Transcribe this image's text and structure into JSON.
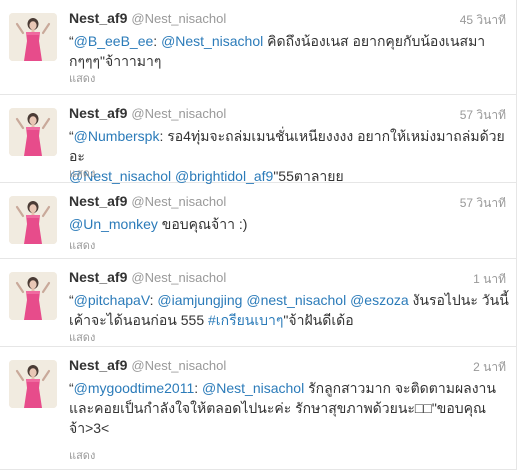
{
  "tweets": [
    {
      "name": "Nest_af9",
      "screen_name": "@Nest_nisachol",
      "time": "45 วินาที",
      "expand": "แสดง",
      "parts": [
        {
          "t": "text",
          "v": "“"
        },
        {
          "t": "mention",
          "v": "@B_eeB_ee"
        },
        {
          "t": "text",
          "v": ": "
        },
        {
          "t": "mention",
          "v": "@Nest_nisachol"
        },
        {
          "t": "text",
          "v": " คิดถึงน้องเนส อยากคุยกับน้องเนสมา\nกๆๆๆ\"จ้าาามาๆ"
        }
      ]
    },
    {
      "name": "Nest_af9",
      "screen_name": "@Nest_nisachol",
      "time": "57 วินาที",
      "expand": "แสดง",
      "parts": [
        {
          "t": "text",
          "v": "“"
        },
        {
          "t": "mention",
          "v": "@Numberspk"
        },
        {
          "t": "text",
          "v": ": รอ4ทุ่มจะถล่มเมนชั่นเหนียงงงง อยากให้เหม่งมาถล่มด้วยอะ\n"
        },
        {
          "t": "mention",
          "v": "@Nest_nisachol"
        },
        {
          "t": "text",
          "v": " "
        },
        {
          "t": "mention",
          "v": "@brightidol_af9"
        },
        {
          "t": "text",
          "v": "\"55ตาลายย"
        }
      ]
    },
    {
      "name": "Nest_af9",
      "screen_name": "@Nest_nisachol",
      "time": "57 วินาที",
      "expand": "แสดง",
      "parts": [
        {
          "t": "mention",
          "v": "@Un_monkey"
        },
        {
          "t": "text",
          "v": " ขอบคุณจ้าา :)"
        }
      ]
    },
    {
      "name": "Nest_af9",
      "screen_name": "@Nest_nisachol",
      "time": "1 นาที",
      "expand": "แสดง",
      "parts": [
        {
          "t": "text",
          "v": "“"
        },
        {
          "t": "mention",
          "v": "@pitchapaV"
        },
        {
          "t": "text",
          "v": ": "
        },
        {
          "t": "mention",
          "v": "@iamjungjing"
        },
        {
          "t": "text",
          "v": " "
        },
        {
          "t": "mention",
          "v": "@nest_nisachol"
        },
        {
          "t": "text",
          "v": " "
        },
        {
          "t": "mention",
          "v": "@eszoza"
        },
        {
          "t": "text",
          "v": " งันรอไปนะ วันนี้\nเค้าจะได้นอนก่อน 555 "
        },
        {
          "t": "hashtag",
          "v": "#เกรียนเบาๆ"
        },
        {
          "t": "text",
          "v": "\"จ้าฝันดีเด้อ"
        }
      ]
    },
    {
      "name": "Nest_af9",
      "screen_name": "@Nest_nisachol",
      "time": "2 นาที",
      "expand": "แสดง",
      "parts": [
        {
          "t": "text",
          "v": "“"
        },
        {
          "t": "mention",
          "v": "@mygoodtime2011"
        },
        {
          "t": "text",
          "v": ": "
        },
        {
          "t": "mention",
          "v": "@Nest_nisachol"
        },
        {
          "t": "text",
          "v": " รักลูกสาวมาก จะติดตามผลงาน\nและคอยเป็นกำลังใจให้ตลอดไปนะค่ะ รักษาสุขภาพด้วยนะ□□\"ขอบคุณ\nจ้า>3<"
        }
      ]
    }
  ],
  "colors": {
    "link": "#2b7bb9",
    "text": "#333333",
    "muted": "#999999",
    "border": "#e6e6e6"
  },
  "icons": {
    "avatar": "avatar-image"
  }
}
